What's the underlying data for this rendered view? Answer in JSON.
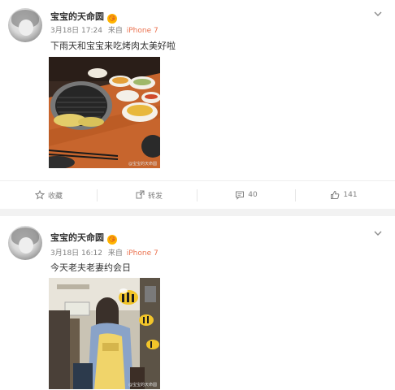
{
  "posts": [
    {
      "author": {
        "name": "宝宝的天命圆",
        "badge": "😘"
      },
      "meta": {
        "time": "3月18日 17:24",
        "source_prefix": "来自",
        "device": "iPhone 7"
      },
      "text": "下雨天和宝宝来吃烤肉太美好啦",
      "image_watermark": "@宝宝的天命圆",
      "actions": {
        "favorite": "收藏",
        "repost": "转发",
        "comments": "40",
        "likes": "141"
      }
    },
    {
      "author": {
        "name": "宝宝的天命圆",
        "badge": "😘"
      },
      "meta": {
        "time": "3月18日 16:12",
        "source_prefix": "来自",
        "device": "iPhone 7"
      },
      "text": "今天老夫老妻约会日",
      "image_watermark": "@宝宝的天命圆"
    }
  ],
  "colors": {
    "text": "#333333",
    "meta": "#808080",
    "source_link": "#eb7350",
    "separator": "#f2f2f2"
  }
}
